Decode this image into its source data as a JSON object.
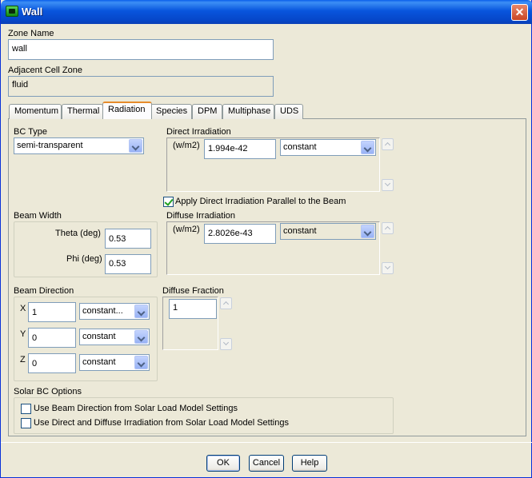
{
  "window": {
    "title": "Wall",
    "close_glyph": "✕",
    "title_icon": "app-icon"
  },
  "zone_name": {
    "label": "Zone Name",
    "value": "wall"
  },
  "adjacent_cell_zone": {
    "label": "Adjacent Cell Zone",
    "value": "fluid"
  },
  "tabs": [
    {
      "label": "Momentum",
      "active": false
    },
    {
      "label": "Thermal",
      "active": false
    },
    {
      "label": "Radiation",
      "active": true
    },
    {
      "label": "Species",
      "active": false
    },
    {
      "label": "DPM",
      "active": false
    },
    {
      "label": "Multiphase",
      "active": false
    },
    {
      "label": "UDS",
      "active": false
    }
  ],
  "radiation": {
    "bc_type": {
      "label": "BC Type",
      "value": "semi-transparent"
    },
    "direct_irradiation": {
      "label": "Direct Irradiation",
      "unit": "(w/m2)",
      "value": "1.994e-42",
      "method": "constant"
    },
    "apply_parallel": {
      "label": "Apply Direct Irradiation Parallel to the Beam",
      "checked": true
    },
    "beam_width": {
      "label": "Beam Width",
      "theta_label": "Theta (deg)",
      "theta_value": "0.53",
      "phi_label": "Phi (deg)",
      "phi_value": "0.53"
    },
    "diffuse_irradiation": {
      "label": "Diffuse Irradiation",
      "unit": "(w/m2)",
      "value": "2.8026e-43",
      "method": "constant"
    },
    "beam_direction": {
      "label": "Beam Direction",
      "x_label": "X",
      "x_value": "1",
      "x_method": "constant...",
      "y_label": "Y",
      "y_value": "0",
      "y_method": "constant",
      "z_label": "Z",
      "z_value": "0",
      "z_method": "constant"
    },
    "diffuse_fraction": {
      "label": "Diffuse Fraction",
      "value": "1"
    },
    "solar_bc": {
      "label": "Solar BC Options",
      "option1": {
        "label": "Use Beam Direction from Solar Load Model Settings",
        "checked": false
      },
      "option2": {
        "label": "Use Direct and Diffuse Irradiation from Solar Load Model Settings",
        "checked": false
      }
    }
  },
  "buttons": {
    "ok": "OK",
    "cancel": "Cancel",
    "help": "Help"
  }
}
